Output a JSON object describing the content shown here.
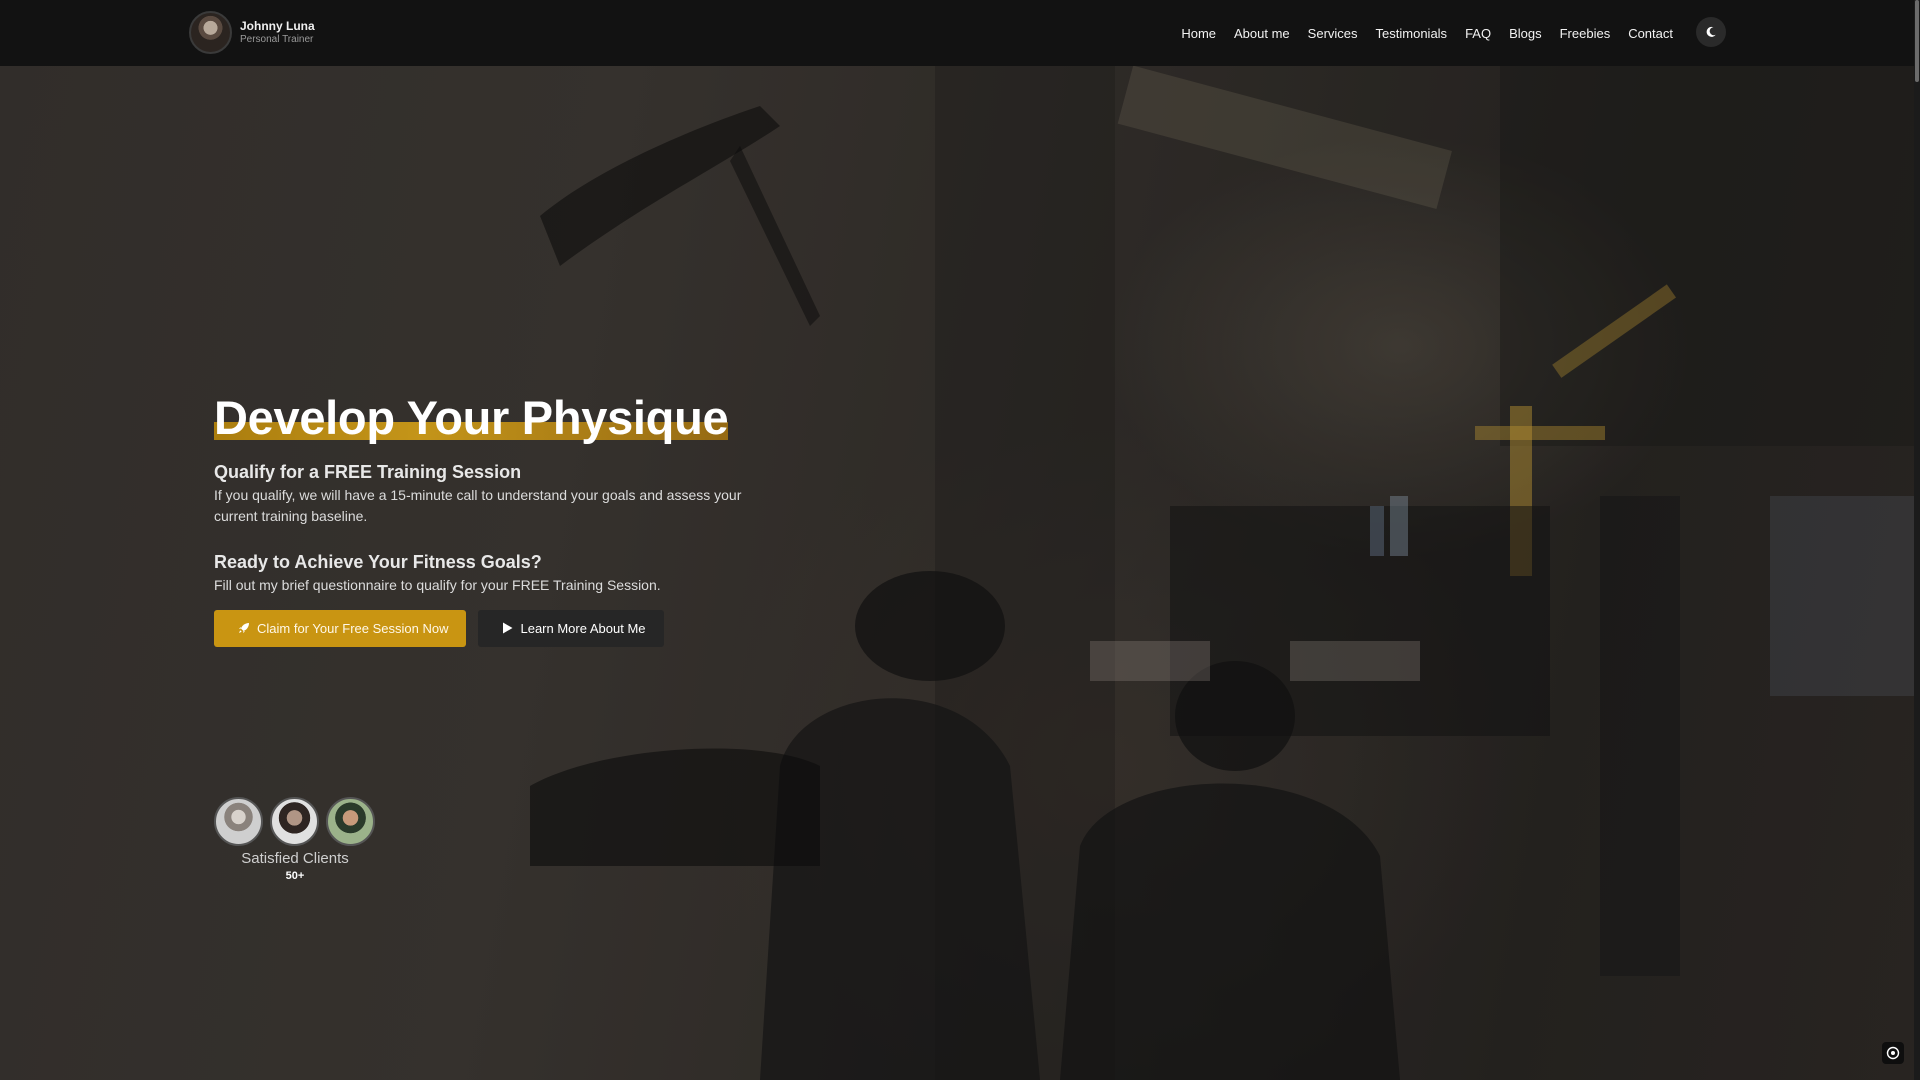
{
  "brand": {
    "name": "Johnny Luna",
    "role": "Personal Trainer"
  },
  "nav": {
    "items": [
      {
        "label": "Home"
      },
      {
        "label": "About me"
      },
      {
        "label": "Services"
      },
      {
        "label": "Testimonials"
      },
      {
        "label": "FAQ"
      },
      {
        "label": "Blogs"
      },
      {
        "label": "Freebies"
      },
      {
        "label": "Contact"
      }
    ],
    "theme_toggle_icon": "moon-icon"
  },
  "hero": {
    "headline": "Develop Your Physique",
    "subhead1": "Qualify for a FREE Training Session",
    "para1": "If you qualify, we will have a 15-minute call to understand your goals and assess your current training baseline.",
    "subhead2": "Ready to Achieve Your Fitness Goals?",
    "para2": "Fill out my brief questionnaire to qualify for your FREE Training Session.",
    "primary_button": {
      "label": "Claim for Your Free Session Now",
      "icon": "rocket-icon"
    },
    "secondary_button": {
      "label": "Learn More About Me",
      "icon": "play-icon"
    }
  },
  "clients": {
    "label": "Satisfied Clients",
    "count": "50+"
  },
  "colors": {
    "accent": "#c99512",
    "navbar_bg": "#121212",
    "text_primary": "#ffffff"
  }
}
